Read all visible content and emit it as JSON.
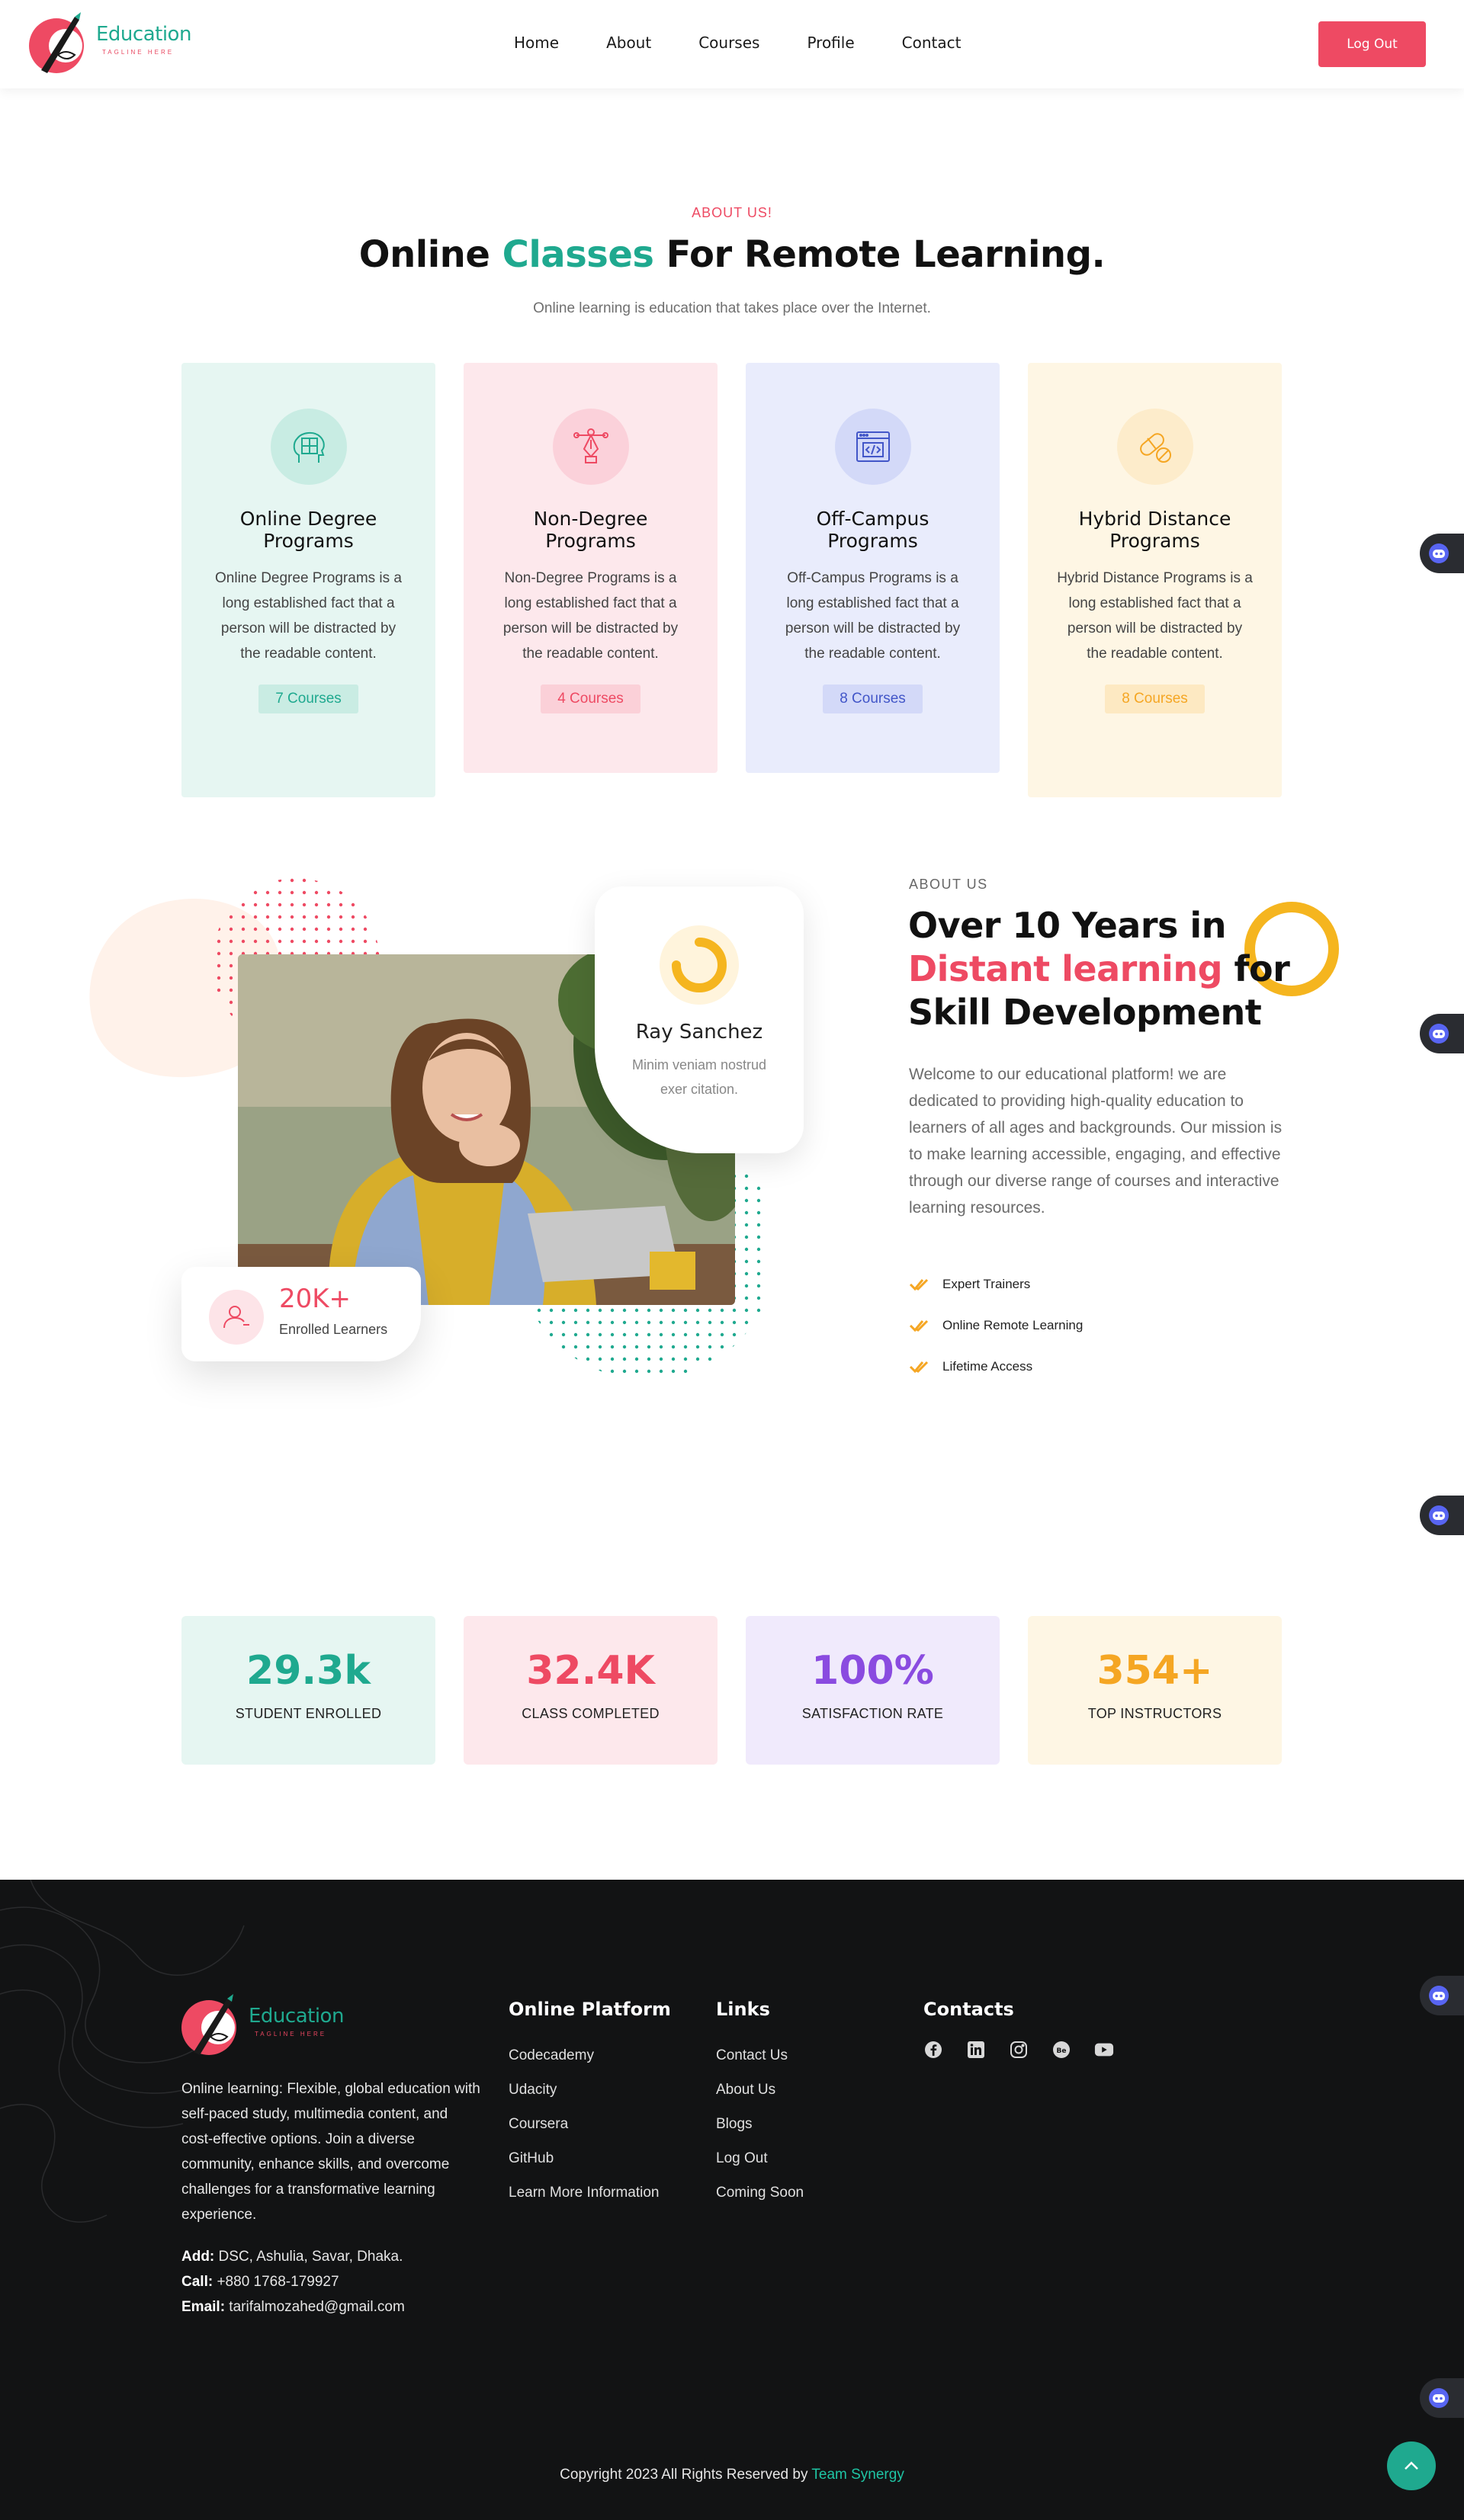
{
  "header": {
    "logo_name": "Education",
    "logo_tagline": "TAGLINE HERE",
    "nav": [
      "Home",
      "About",
      "Courses",
      "Profile",
      "Contact"
    ],
    "logout_label": "Log Out"
  },
  "programs": {
    "eyebrow": "ABOUT US!",
    "title_pre": "Online ",
    "title_accent": "Classes",
    "title_post": " For Remote Learning.",
    "subtitle": "Online learning is education that takes place over the Internet.",
    "cards": [
      {
        "title": "Online Degree Programs",
        "desc": "Online Degree Programs is a long established fact that a person will be distracted by the readable content.",
        "badge": "7 Courses",
        "icon": "brain-puzzle-icon",
        "bg": "#e6f6f2",
        "icon_bg": "#c8ece3",
        "accent": "#1fa98f",
        "badge_bg": "#c9ece3"
      },
      {
        "title": "Non-Degree Programs",
        "desc": "Non-Degree Programs is a long established fact that a person will be distracted by the readable content.",
        "badge": "4 Courses",
        "icon": "pen-tool-icon",
        "bg": "#fde8ec",
        "icon_bg": "#fbd1da",
        "accent": "#ee4a63",
        "badge_bg": "#fbd0d8"
      },
      {
        "title": "Off-Campus Programs",
        "desc": "Off-Campus Programs is a long established fact that a person will be distracted by the readable content.",
        "badge": "8 Courses",
        "icon": "code-window-icon",
        "bg": "#e9ecfc",
        "icon_bg": "#d3d9f8",
        "accent": "#4256c8",
        "badge_bg": "#d3d9f8"
      },
      {
        "title": "Hybrid Distance Programs",
        "desc": "Hybrid Distance Programs is a long established fact that a person will be distracted by the readable content.",
        "badge": "8 Courses",
        "icon": "pill-icon",
        "bg": "#fef6e4",
        "icon_bg": "#fdeccb",
        "accent": "#f5a623",
        "badge_bg": "#fde9c2"
      }
    ]
  },
  "about": {
    "profile_name": "Ray Sanchez",
    "profile_desc": "Minim veniam nostrud exer citation.",
    "learners_count": "20K+",
    "learners_label": "Enrolled Learners",
    "eyebrow": "ABOUT US",
    "heading_line1": "Over 10 Years in",
    "heading_pink": "Distant learning",
    "heading_after_pink": " for",
    "heading_line3": "Skill Development",
    "body": "Welcome to our educational platform! we are dedicated to providing high-quality education to learners of all ages and backgrounds. Our mission is to make learning accessible, engaging, and effective through our diverse range of courses and interactive learning resources.",
    "checks": [
      "Expert Trainers",
      "Online Remote Learning",
      "Lifetime Access"
    ]
  },
  "stats": [
    {
      "value": "29.3k",
      "label": "STUDENT ENROLLED",
      "color": "#1fa98f",
      "bg": "#e6f6f2"
    },
    {
      "value": "32.4K",
      "label": "CLASS COMPLETED",
      "color": "#ee4a63",
      "bg": "#fde8ec"
    },
    {
      "value": "100%",
      "label": "SATISFACTION RATE",
      "color": "#8a4be0",
      "bg": "#f0eafc"
    },
    {
      "value": "354+",
      "label": "TOP INSTRUCTORS",
      "color": "#f5a623",
      "bg": "#fef6e4"
    }
  ],
  "footer": {
    "logo_name": "Education",
    "logo_tagline": "TAGLINE HERE",
    "about": "Online learning: Flexible, global education with self-paced study, multimedia content, and cost-effective options. Join a diverse community, enhance skills, and overcome challenges for a transformative learning experience.",
    "add_label": "Add:",
    "add_value": " DSC, Ashulia, Savar, Dhaka.",
    "call_label": "Call:",
    "call_value": " +880 1768-179927",
    "email_label": "Email:",
    "email_value": " tarifalmozahed@gmail.com",
    "platform_title": "Online Platform",
    "platform_links": [
      "Codecademy",
      "Udacity",
      "Coursera",
      "GitHub",
      "Learn More Information"
    ],
    "links_title": "Links",
    "links": [
      "Contact Us",
      "About Us",
      "Blogs",
      "Log Out",
      "Coming Soon"
    ],
    "contacts_title": "Contacts",
    "socials": [
      "facebook-icon",
      "linkedin-icon",
      "instagram-icon",
      "dribbble-icon",
      "youtube-icon"
    ],
    "copyright_pre": "Copyright 2023 All Rights Reserved by ",
    "copyright_team": "Team Synergy"
  }
}
